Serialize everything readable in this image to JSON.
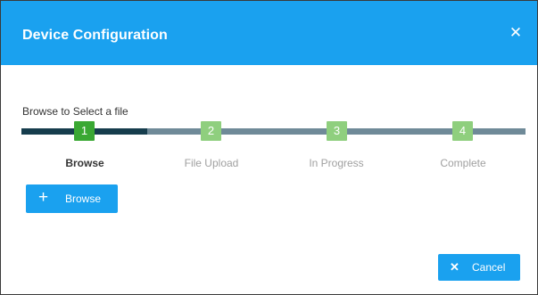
{
  "dialog": {
    "title": "Device Configuration",
    "close_icon": "close-icon",
    "close_glyph": "✕"
  },
  "wizard": {
    "caption": "Browse to Select a file",
    "steps": [
      {
        "number": "1",
        "label": "Browse",
        "state": "active"
      },
      {
        "number": "2",
        "label": "File Upload",
        "state": "inactive"
      },
      {
        "number": "3",
        "label": "In Progress",
        "state": "inactive"
      },
      {
        "number": "4",
        "label": "Complete",
        "state": "inactive"
      }
    ]
  },
  "buttons": {
    "browse": {
      "label": "Browse",
      "icon": "plus-icon",
      "glyph": "+"
    },
    "cancel": {
      "label": "Cancel",
      "icon": "close-icon",
      "glyph": "✕"
    }
  },
  "colors": {
    "header": "#1aa1ef",
    "button": "#1aa1ef",
    "track_done": "#163d4d",
    "track_pending": "#6f8a98",
    "step_active": "#3aa833",
    "step_inactive": "#8fcf7e"
  }
}
